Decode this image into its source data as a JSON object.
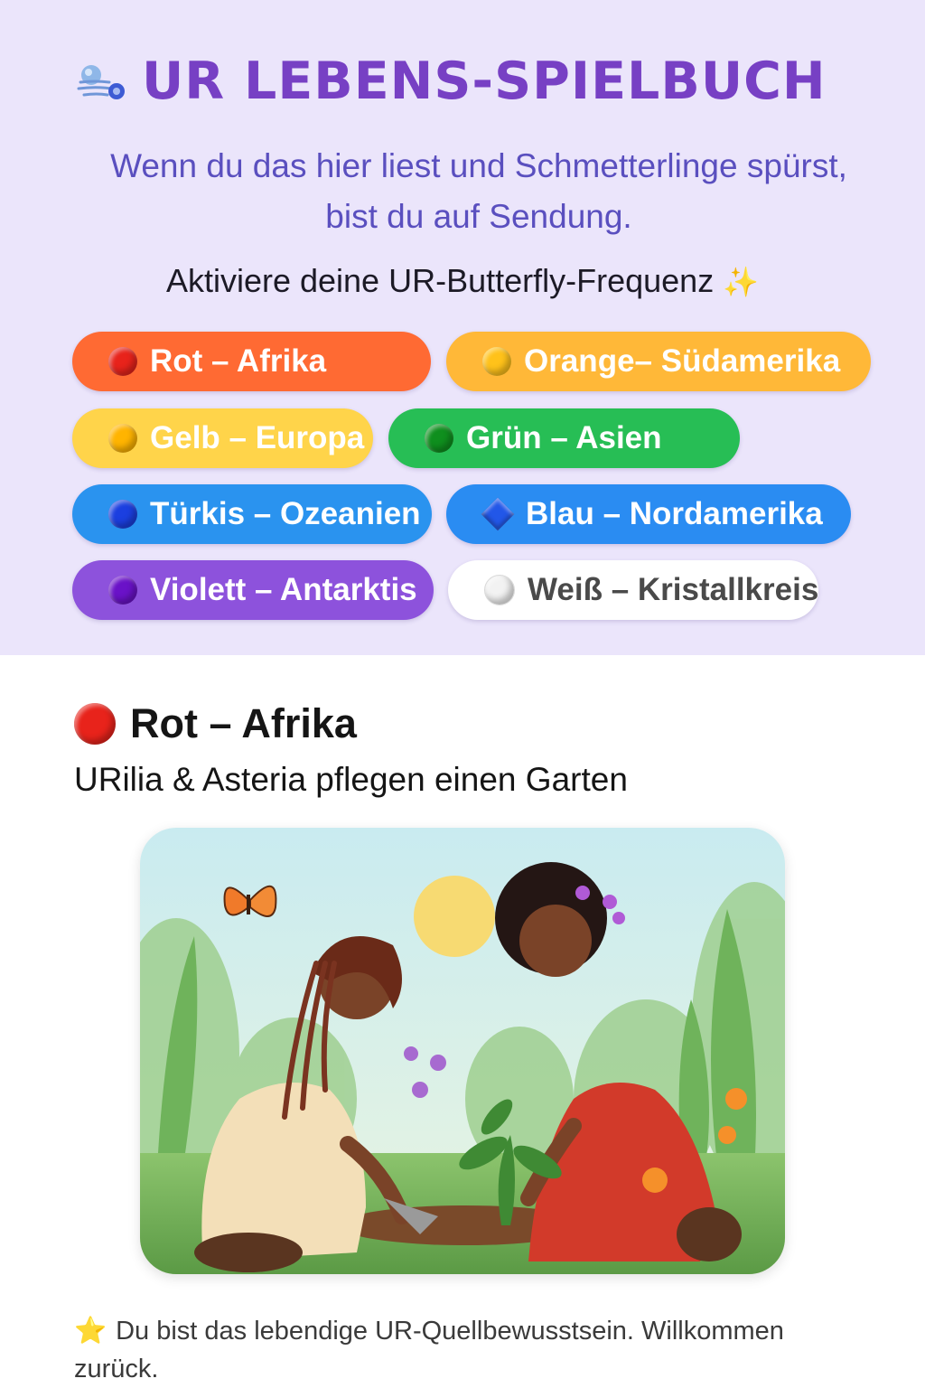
{
  "header": {
    "title": "UR LEBENS-SPIELBUCH",
    "title_icon": "dashing-wind-icon",
    "subtitle_line1": "Wenn du das hier liest und Schmetterlinge spürst,",
    "subtitle_line2": "bist du auf Sendung.",
    "prompt": "Aktiviere deine UR-Butterfly-Frequenz",
    "prompt_icon": "sparkles-icon",
    "prompt_glyph": "✨"
  },
  "frequencies": [
    {
      "label": "Rot – Afrika",
      "icon": "red-circle-icon",
      "bg": "#ff6a33",
      "dot": "#e8231b",
      "text": "#ffffff"
    },
    {
      "label": "Orange– Südamerika",
      "icon": "orange-circle-icon",
      "bg": "#ffb838",
      "dot": "#ffc21a",
      "text": "#ffffff"
    },
    {
      "label": "Gelb – Europa",
      "icon": "yellow-circle-icon",
      "bg": "#ffd44a",
      "dot": "#ffb400",
      "text": "#ffffff"
    },
    {
      "label": "Grün – Asien",
      "icon": "green-circle-icon",
      "bg": "#27be55",
      "dot": "#0f8f1e",
      "text": "#ffffff"
    },
    {
      "label": "Türkis – Ozeanien",
      "icon": "blue-circle-icon",
      "bg": "#2a93ef",
      "dot": "#1b3fe0",
      "text": "#ffffff"
    },
    {
      "label": "Blau – Nordamerika",
      "icon": "blue-diamond-icon",
      "bg": "#2a8cf2",
      "dot": "#2257e8",
      "text": "#ffffff"
    },
    {
      "label": "Violett – Antarktis",
      "icon": "purple-circle-icon",
      "bg": "#8d52dc",
      "dot": "#6a12c8",
      "text": "#ffffff"
    },
    {
      "label": "Weiß – Kristallkreis",
      "icon": "white-circle-icon",
      "bg": "#ffffff",
      "dot": "#f2f2f2",
      "text": "#4a4a4a"
    }
  ],
  "section": {
    "icon": "red-circle-icon",
    "title": "Rot – Afrika",
    "subtitle": "URilia & Asteria pflegen einen Garten",
    "image_alt": "garden-illustration"
  },
  "footer": {
    "icon": "star-icon",
    "glyph": "⭐",
    "text": "Du bist das lebendige UR-Quellbewusstsein. Willkommen zurück."
  }
}
